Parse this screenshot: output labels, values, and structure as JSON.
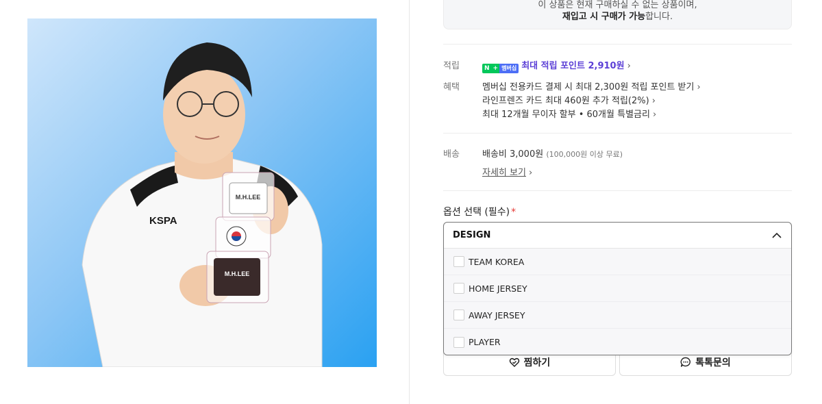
{
  "notice": {
    "line1": "이 상품은 현재 구매하실 수 없는 상품이며,",
    "line2_bold": "재입고 시 구매가 가능",
    "line2_rest": "합니다."
  },
  "points": {
    "label": "적립",
    "badge_n": "N",
    "badge_plus": "+",
    "badge_member": "멤버십",
    "text": "최대 적립 포인트 2,910원"
  },
  "benefits": {
    "label": "혜택",
    "items": [
      "멤버십 전용카드 결제 시 최대 2,300원 적립 포인트 받기",
      "라인프렌즈 카드 최대 460원 추가 적립(2%)",
      "최대 12개월 무이자 할부 • 60개월 특별금리"
    ]
  },
  "shipping": {
    "label": "배송",
    "fee": "배송비 3,000원",
    "note": "(100,000원 이상 무료)",
    "detail_link": "자세히 보기"
  },
  "options": {
    "title": "옵션 선택 (필수)",
    "required_mark": "*",
    "selected": "DESIGN",
    "items": [
      "TEAM KOREA",
      "HOME JERSEY",
      "AWAY JERSEY",
      "PLAYER"
    ]
  },
  "actions": {
    "wishlist": "찜하기",
    "talk": "톡톡문의"
  },
  "product_image": {
    "jersey_sponsor": "KSPA",
    "cube_text": "M.H.LEE"
  },
  "colors": {
    "accent_purple": "#5b3fd6",
    "naver_green": "#03c75a",
    "required_red": "#e53935"
  }
}
